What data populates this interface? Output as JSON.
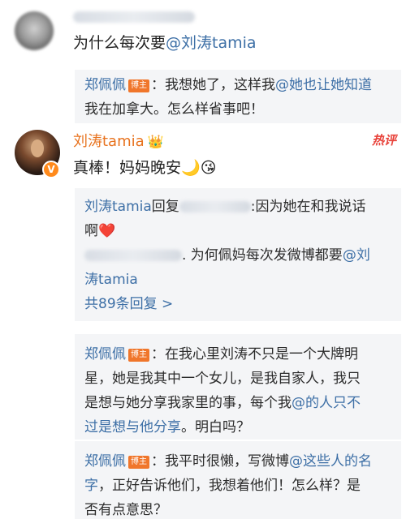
{
  "top_comment": {
    "text_prefix": "为什么每次要",
    "mention": "@刘涛tamia"
  },
  "reply1": {
    "author": "郑佩佩",
    "badge": "博主",
    "text_prefix": "：我想她了，这样我",
    "mention": "@她也让她知道",
    "text_rest": "我在加拿大。怎么样省事吧！"
  },
  "main_comment": {
    "author": "刘涛tamia",
    "crown_icon": "👑",
    "verified_icon": "V",
    "hot_label": "热评",
    "text": "真棒！妈妈晚安",
    "emoji1": "🌙",
    "emoji2": "😘"
  },
  "subreplies": {
    "line1_author": "刘涛tamia",
    "line1_reply_word": "回复",
    "line1_text": ":因为她在和我说话",
    "line1_wrap": "啊",
    "heart": "❤️",
    "line2_text": ". 为何佩妈每次发微博都要",
    "line2_mention": "@刘",
    "line2_mention_wrap": "涛tamia",
    "more_label": "共89条回复",
    "more_icon": ">"
  },
  "reply2": {
    "author": "郑佩佩",
    "badge": "博主",
    "line1": "：在我心里刘涛不只是一个大牌明",
    "line2": "星，她是我其中一个女儿，是我自家人，我只",
    "line3_prefix": "是想与她分享我家里的事，每个我",
    "line3_mention": "@的人只不",
    "line4_mention": "过是想与他分享",
    "line4_rest": "。明白吗？"
  },
  "reply3": {
    "author": "郑佩佩",
    "badge": "博主",
    "line1_prefix": "：我平时很懒，写微博",
    "line1_mention": "@这些人的名",
    "line2_mention": "字",
    "line2_rest": "，正好告诉他们，我想着他们！怎么样？是",
    "line3": "否有点意思？"
  }
}
